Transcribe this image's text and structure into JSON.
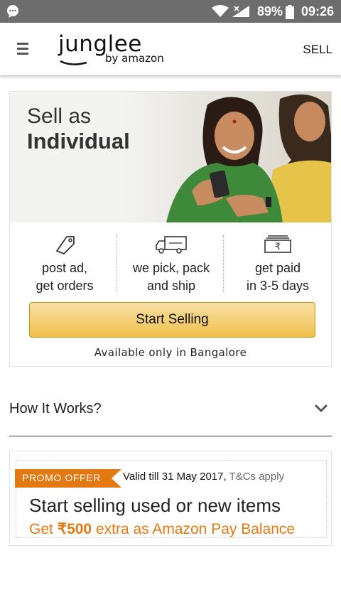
{
  "status_bar": {
    "battery": "89%",
    "time": "09:26"
  },
  "app_bar": {
    "logo_main": "junglee",
    "logo_sub": "by amazon",
    "sell_link": "SELL"
  },
  "hero": {
    "title_line1": "Sell as",
    "title_line2": "Individual"
  },
  "features": [
    {
      "icon": "tag-icon",
      "line1": "post ad,",
      "line2": "get orders"
    },
    {
      "icon": "delivery-truck-icon",
      "line1": "we pick, pack",
      "line2": "and ship"
    },
    {
      "icon": "rupee-cash-icon",
      "line1": "get paid",
      "line2": "in 3-5 days"
    }
  ],
  "start_selling_label": "Start Selling",
  "availability": "Available only in Bangalore",
  "how_it_works": {
    "title": "How It Works?"
  },
  "promo": {
    "tag": "PROMO OFFER",
    "valid_text": "Valid till 31 May 2017,",
    "terms": "T&Cs apply",
    "headline": "Start selling used or new items",
    "sub_prefix": "Get",
    "sub_amount": "₹500",
    "sub_suffix": "extra as Amazon Pay Balance"
  },
  "colors": {
    "status_bar_bg": "#6d6d6d",
    "button_gradient_top": "#f7dfa5",
    "button_gradient_bottom": "#f0c14b",
    "promo_tag_bg": "#e47911",
    "promo_sub_text": "#e47911"
  }
}
